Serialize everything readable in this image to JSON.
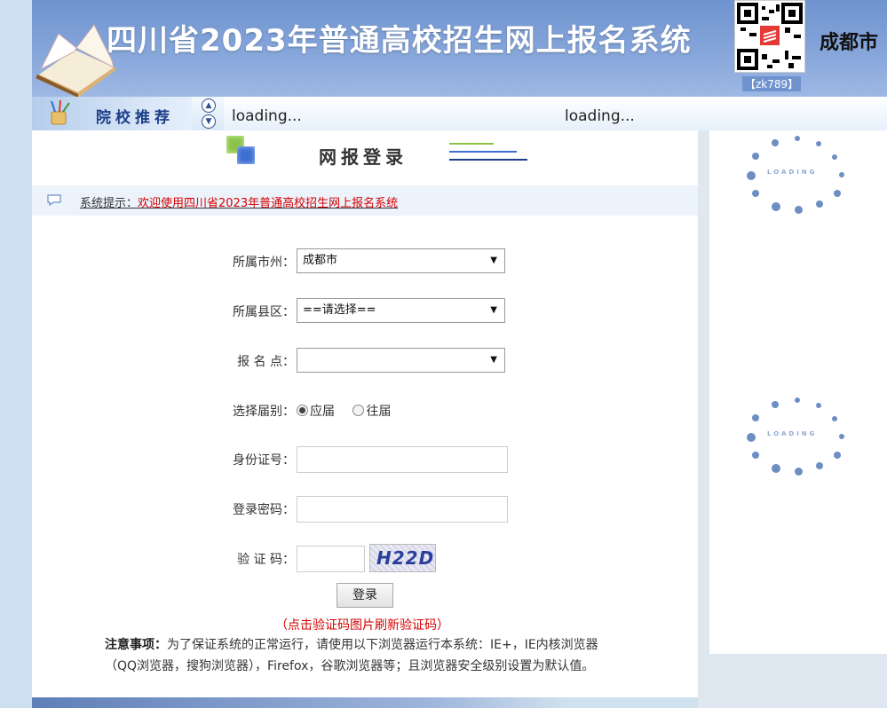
{
  "header": {
    "title": "四川省2023年普通高校招生网上报名系统",
    "qr_caption": "【zk789】",
    "city": "成都市"
  },
  "recommend_bar": {
    "label": "院校推荐",
    "ticker": [
      "loading...",
      "loading..."
    ]
  },
  "main": {
    "page_title": "网报登录",
    "tip_prefix": "系统提示：",
    "tip_message": "欢迎使用四川省2023年普通高校招生网上报名系统"
  },
  "form": {
    "city_label": "所属市州：",
    "city_value": "成都市",
    "district_label": "所属县区：",
    "district_value": "==请选择==",
    "site_label": "报 名 点：",
    "site_value": "",
    "grad_label": "选择届别：",
    "grad_options": [
      "应届",
      "往届"
    ],
    "grad_selected": "应届",
    "id_label": "身份证号：",
    "id_value": "",
    "password_label": "登录密码：",
    "password_value": "",
    "captcha_label": "验 证 码：",
    "captcha_value": "",
    "captcha_image_text": "H22D",
    "login_button": "登录",
    "refresh_hint": "（点击验证码图片刷新验证码）"
  },
  "notice": {
    "heading": "注意事项：",
    "body": "为了保证系统的正常运行，请使用以下浏览器运行本系统：IE+，IE内核浏览器（QQ浏览器，搜狗浏览器），Firefox，谷歌浏览器等；且浏览器安全级别设置为默认值。"
  },
  "right_panel": {
    "loader_text": "LOADING"
  },
  "colors": {
    "banner": "#7a9dd6",
    "accent_blue": "#1d3f8a",
    "tip_red": "#d60000",
    "green": "#8bc34a"
  }
}
